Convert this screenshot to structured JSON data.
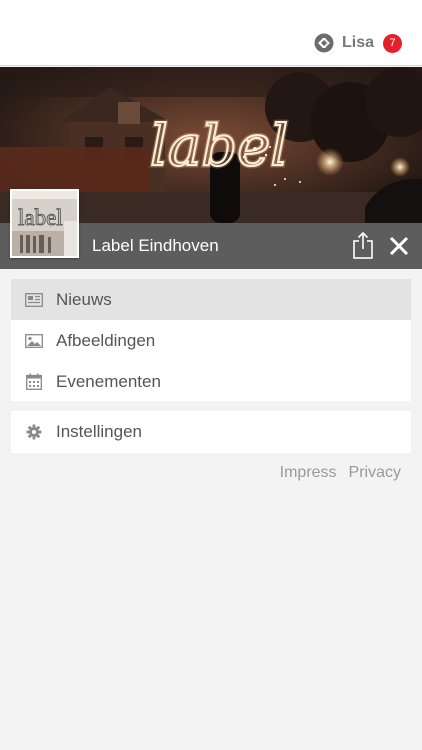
{
  "header": {
    "user_name": "Lisa",
    "notification_count": "7",
    "badge_color": "#e4202c",
    "user_icon": "app-logo-icon"
  },
  "page": {
    "name": "Label Eindhoven",
    "cover_text": "label",
    "avatar_text": "label",
    "titlebar_color": "#5d5d5d"
  },
  "menu": {
    "items": [
      {
        "label": "Nieuws",
        "icon": "newspaper-icon",
        "active": true
      },
      {
        "label": "Afbeeldingen",
        "icon": "image-icon",
        "active": false
      },
      {
        "label": "Evenementen",
        "icon": "calendar-icon",
        "active": false
      }
    ],
    "settings": {
      "label": "Instellingen",
      "icon": "gear-icon"
    }
  },
  "footer": {
    "impress": "Impress",
    "privacy": "Privacy"
  }
}
